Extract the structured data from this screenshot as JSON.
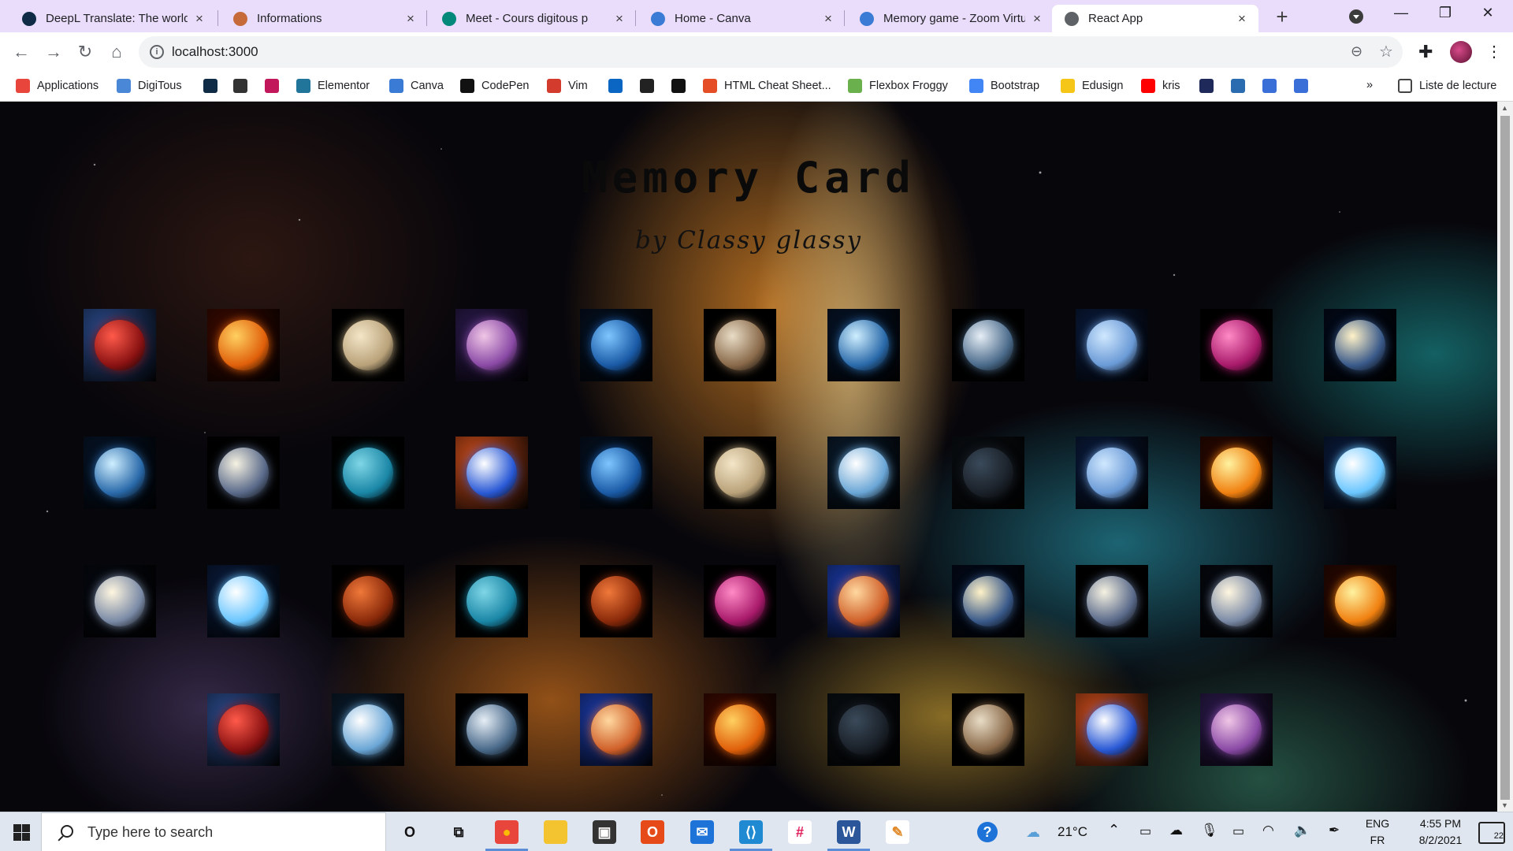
{
  "browser": {
    "tabs": [
      {
        "title": "DeepL Translate: The world'",
        "favicon": "deepl-icon",
        "color": "#0f2b46"
      },
      {
        "title": "Informations",
        "favicon": "key-icon",
        "color": "#c76a3a"
      },
      {
        "title": "Meet - Cours digitous p",
        "favicon": "meet-icon",
        "color": "#00897b"
      },
      {
        "title": "Home - Canva",
        "favicon": "canva-icon",
        "color": "#3a7bd5"
      },
      {
        "title": "Memory game - Zoom Virtu",
        "favicon": "canva-icon",
        "color": "#3a7bd5"
      },
      {
        "title": "React App",
        "favicon": "globe-icon",
        "color": "#5f6368"
      }
    ],
    "active_tab": 5,
    "address": "localhost:3000"
  },
  "bookmarks": [
    {
      "label": "Applications",
      "icon": "apps-grid-icon",
      "color": "#e8453c"
    },
    {
      "label": "DigiTous",
      "icon": "folder-icon",
      "color": "#4a87d6"
    },
    {
      "label": "",
      "icon": "deepl-icon",
      "color": "#0f2b46"
    },
    {
      "label": "",
      "icon": "code-icon",
      "color": "#333333"
    },
    {
      "label": "",
      "icon": "sitemark-icon",
      "color": "#c2185b"
    },
    {
      "label": "Elementor",
      "icon": "wordpress-icon",
      "color": "#21759b"
    },
    {
      "label": "Canva",
      "icon": "canva-icon",
      "color": "#3a7bd5"
    },
    {
      "label": "CodePen",
      "icon": "codepen-icon",
      "color": "#111111"
    },
    {
      "label": "Vim",
      "icon": "vim-icon",
      "color": "#d33b2c"
    },
    {
      "label": "",
      "icon": "linkedin-icon",
      "color": "#0a66c2"
    },
    {
      "label": "",
      "icon": "u-icon",
      "color": "#222222"
    },
    {
      "label": "",
      "icon": "github-icon",
      "color": "#111111"
    },
    {
      "label": "HTML Cheat Sheet...",
      "icon": "html5-icon",
      "color": "#e44d26"
    },
    {
      "label": "Flexbox Froggy",
      "icon": "frog-icon",
      "color": "#6ab04c"
    },
    {
      "label": "Bootstrap",
      "icon": "google-icon",
      "color": "#4285f4"
    },
    {
      "label": "Edusign",
      "icon": "pen-icon",
      "color": "#f5c518"
    },
    {
      "label": "kris",
      "icon": "youtube-icon",
      "color": "#ff0000"
    },
    {
      "label": "",
      "icon": "e-icon",
      "color": "#1f2a5a"
    },
    {
      "label": "",
      "icon": "doc-icon",
      "color": "#2b6cb0"
    },
    {
      "label": "",
      "icon": "puzzle-icon",
      "color": "#3a6fd8"
    },
    {
      "label": "",
      "icon": "accessibility-icon",
      "color": "#3a6fd8"
    }
  ],
  "reading_list": "Liste de lecture",
  "overflow": "»",
  "page": {
    "title": "Memory Card",
    "subtitle": "by Classy glassy"
  },
  "cards": [
    {
      "name": "red-striped-planet",
      "colors": [
        "#ff5a4a",
        "#8a1212",
        "#2a4a8a"
      ]
    },
    {
      "name": "sun",
      "colors": [
        "#ffd060",
        "#e0600a",
        "#3a0a00"
      ]
    },
    {
      "name": "saturn",
      "colors": [
        "#f4e6c8",
        "#b9a27a",
        "#000000"
      ]
    },
    {
      "name": "nebula-mountains",
      "colors": [
        "#f0c6e6",
        "#8a4aa6",
        "#2a1a4a"
      ]
    },
    {
      "name": "orbit-system",
      "colors": [
        "#7ec6ff",
        "#1a5aa6",
        "#051020"
      ]
    },
    {
      "name": "moon-rocky",
      "colors": [
        "#e8dcc6",
        "#8a6a4a",
        "#000000"
      ]
    },
    {
      "name": "black-hole-vortex",
      "colors": [
        "#cfefff",
        "#2a6aaa",
        "#061428"
      ]
    },
    {
      "name": "earth",
      "colors": [
        "#e6eef6",
        "#4a6a8a",
        "#000000"
      ]
    },
    {
      "name": "blue-ice-planet",
      "colors": [
        "#d0e8ff",
        "#6a9ad6",
        "#0a1a3a"
      ]
    },
    {
      "name": "pink-gas-giant",
      "colors": [
        "#ff8ac6",
        "#a81a6a",
        "#000000"
      ]
    },
    {
      "name": "planet-sunrise",
      "colors": [
        "#fff2c8",
        "#3a5a8a",
        "#020a1a"
      ]
    },
    {
      "name": "black-hole-vortex",
      "colors": [
        "#cfefff",
        "#2a6aaa",
        "#061428"
      ]
    },
    {
      "name": "crescent-rings",
      "colors": [
        "#f6f2e2",
        "#5a6a8a",
        "#000000"
      ]
    },
    {
      "name": "uranus",
      "colors": [
        "#7fd6e6",
        "#1a86a6",
        "#000000"
      ]
    },
    {
      "name": "lightning-planet",
      "colors": [
        "#ffffff",
        "#2a5ad6",
        "#c64a1a"
      ]
    },
    {
      "name": "orbit-system",
      "colors": [
        "#7ec6ff",
        "#1a5aa6",
        "#051020"
      ]
    },
    {
      "name": "saturn",
      "colors": [
        "#f4e6c8",
        "#b9a27a",
        "#000000"
      ]
    },
    {
      "name": "galaxy-burst",
      "colors": [
        "#ffffff",
        "#6aa6d6",
        "#0a1a2a"
      ]
    },
    {
      "name": "dark-planet",
      "colors": [
        "#3a4a5a",
        "#1a2028",
        "#0a0e12"
      ]
    },
    {
      "name": "blue-ice-planet",
      "colors": [
        "#d0e8ff",
        "#6a9ad6",
        "#0a1a3a"
      ]
    },
    {
      "name": "orange-star",
      "colors": [
        "#fff2a0",
        "#f08010",
        "#2a0800"
      ]
    },
    {
      "name": "blue-comet",
      "colors": [
        "#ffffff",
        "#6ac6ff",
        "#0a1a3a"
      ]
    },
    {
      "name": "andromeda-galaxy",
      "colors": [
        "#fff6e0",
        "#7a8aa6",
        "#05080f"
      ]
    },
    {
      "name": "blue-comet",
      "colors": [
        "#ffffff",
        "#6ac6ff",
        "#0a1a3a"
      ]
    },
    {
      "name": "mars",
      "colors": [
        "#f0783a",
        "#8a2a0a",
        "#000000"
      ]
    },
    {
      "name": "uranus",
      "colors": [
        "#7fd6e6",
        "#1a86a6",
        "#000000"
      ]
    },
    {
      "name": "mars",
      "colors": [
        "#f0783a",
        "#8a2a0a",
        "#000000"
      ]
    },
    {
      "name": "pink-gas-giant",
      "colors": [
        "#ff8ac6",
        "#a81a6a",
        "#000000"
      ]
    },
    {
      "name": "fiery-blue-planet",
      "colors": [
        "#ffd8a0",
        "#d0602a",
        "#1a3aa6"
      ]
    },
    {
      "name": "planet-sunrise",
      "colors": [
        "#fff2c8",
        "#3a5a8a",
        "#020a1a"
      ]
    },
    {
      "name": "crescent-rings",
      "colors": [
        "#f6f2e2",
        "#5a6a8a",
        "#000000"
      ]
    },
    {
      "name": "andromeda-galaxy",
      "colors": [
        "#fff6e0",
        "#7a8aa6",
        "#05080f"
      ]
    },
    {
      "name": "orange-star",
      "colors": [
        "#fff2a0",
        "#f08010",
        "#2a0800"
      ]
    },
    {
      "name": "red-striped-planet",
      "colors": [
        "#ff5a4a",
        "#8a1212",
        "#2a4a8a"
      ]
    },
    {
      "name": "galaxy-burst",
      "colors": [
        "#ffffff",
        "#6aa6d6",
        "#0a1a2a"
      ]
    },
    {
      "name": "earth",
      "colors": [
        "#e6eef6",
        "#4a6a8a",
        "#000000"
      ]
    },
    {
      "name": "fiery-blue-planet",
      "colors": [
        "#ffd8a0",
        "#d0602a",
        "#1a3aa6"
      ]
    },
    {
      "name": "sun",
      "colors": [
        "#ffd060",
        "#e0600a",
        "#3a0a00"
      ]
    },
    {
      "name": "dark-planet",
      "colors": [
        "#3a4a5a",
        "#1a2028",
        "#0a0e12"
      ]
    },
    {
      "name": "moon-rocky",
      "colors": [
        "#e8dcc6",
        "#8a6a4a",
        "#000000"
      ]
    },
    {
      "name": "lightning-planet",
      "colors": [
        "#ffffff",
        "#2a5ad6",
        "#c64a1a"
      ]
    },
    {
      "name": "nebula-mountains",
      "colors": [
        "#f0c6e6",
        "#8a4aa6",
        "#2a1a4a"
      ]
    }
  ],
  "taskbar": {
    "search_placeholder": "Type here to search",
    "apps": [
      {
        "name": "cortana-icon",
        "glyph": "O",
        "color": "transparent",
        "fg": "#111111",
        "active": false
      },
      {
        "name": "task-view-icon",
        "glyph": "⧉",
        "color": "transparent",
        "fg": "#111111",
        "active": false
      },
      {
        "name": "chrome-icon",
        "glyph": "●",
        "color": "#e8453c",
        "fg": "#fbbc04",
        "active": true
      },
      {
        "name": "file-explorer-icon",
        "glyph": "▬",
        "color": "#f4c430",
        "fg": "#f4c430",
        "active": false
      },
      {
        "name": "store-icon",
        "glyph": "▣",
        "color": "#333333",
        "fg": "#ffffff",
        "active": false
      },
      {
        "name": "office-icon",
        "glyph": "O",
        "color": "#e64a19",
        "fg": "#ffffff",
        "active": false
      },
      {
        "name": "mail-icon",
        "glyph": "✉",
        "color": "#1e73d8",
        "fg": "#ffffff",
        "active": false
      },
      {
        "name": "vscode-icon",
        "glyph": "⟨⟩",
        "color": "#1f8ad2",
        "fg": "#ffffff",
        "active": true
      },
      {
        "name": "slack-icon",
        "glyph": "#",
        "color": "#ffffff",
        "fg": "#e01e5a",
        "active": false
      },
      {
        "name": "word-icon",
        "glyph": "W",
        "color": "#2b579a",
        "fg": "#ffffff",
        "active": true
      },
      {
        "name": "paint-icon",
        "glyph": "✎",
        "color": "#ffffff",
        "fg": "#e08a2a",
        "active": false
      }
    ],
    "help_badge": "?",
    "weather": "21°C",
    "language_top": "ENG",
    "language_bottom": "FR",
    "time": "4:55 PM",
    "date": "8/2/2021",
    "notifications": "22"
  }
}
